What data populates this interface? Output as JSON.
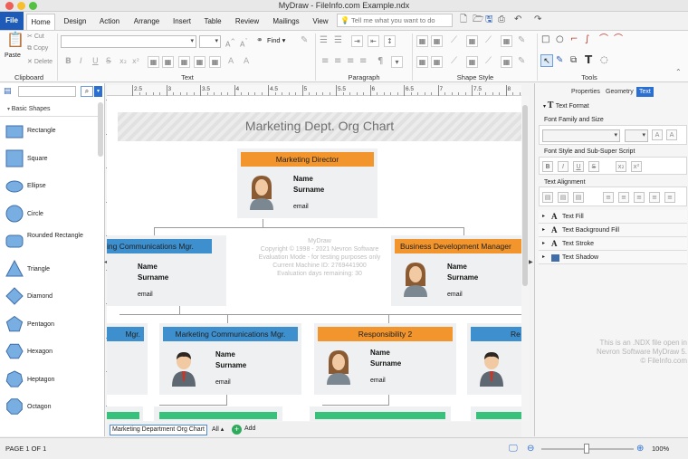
{
  "window": {
    "title": "MyDraw - FileInfo.com Example.ndx"
  },
  "ribbon": {
    "file_tab": "File",
    "tabs": [
      "Home",
      "Design",
      "Action",
      "Arrange",
      "Insert",
      "Table",
      "Review",
      "Mailings",
      "View"
    ],
    "search_placeholder": "Tell me what you want to do",
    "clipboard": {
      "paste": "Paste",
      "cut": "Cut",
      "copy": "Copy",
      "delete": "Delete"
    },
    "find_label": "Find",
    "groups": [
      "Clipboard",
      "Text",
      "Paragraph",
      "Shape Style",
      "Tools"
    ]
  },
  "left_panel": {
    "category": "Basic Shapes",
    "shapes": [
      "Rectangle",
      "Square",
      "Ellipse",
      "Circle",
      "Rounded Rectangle",
      "Triangle",
      "Diamond",
      "Pentagon",
      "Hexagon",
      "Heptagon",
      "Octagon"
    ]
  },
  "rulers": {
    "top_ticks": [
      "2.5",
      "3",
      "3.5",
      "4",
      "4.5",
      "5",
      "5.5",
      "6",
      "6.5",
      "7",
      "7.5",
      "8"
    ]
  },
  "diagram": {
    "title": "Marketing Dept. Org Chart",
    "cards": [
      {
        "title": "Marketing Director",
        "name": "Name",
        "surname": "Surname",
        "email": "email"
      },
      {
        "title": "ing Communications Mgr.",
        "name": "Name",
        "surname": "Surname",
        "email": "email"
      },
      {
        "title": "Business Development Manager",
        "name": "Name",
        "surname": "Surname",
        "email": "email"
      },
      {
        "title": "Mgr."
      },
      {
        "title": "Marketing Communications Mgr.",
        "name": "Name",
        "surname": "Surname",
        "email": "email"
      },
      {
        "title": "Responsibility 2",
        "name": "Name",
        "surname": "Surname",
        "email": "email"
      },
      {
        "title": "Re"
      }
    ],
    "watermark": [
      "MyDraw",
      "Copyright © 1998 - 2021 Nevron Software",
      "Evaluation Mode - for testing purposes only",
      "Current Machine ID: 2769441900",
      "Evaluation days remaining: 30"
    ]
  },
  "page_tabs": {
    "current": "Marketing Department Org Chart",
    "all": "All",
    "add": "Add"
  },
  "right_panel": {
    "tabs": [
      "Properties",
      "Geometry",
      "Text"
    ],
    "title": "Text Format",
    "font_section": "Font Family and Size",
    "style_section": "Font Style and Sub-Super Script",
    "align_section": "Text Alignment",
    "expanders": [
      "Text Fill",
      "Text Background Fill",
      "Text Stroke",
      "Text Shadow"
    ],
    "info": [
      "This is an .NDX file open in",
      "Nevron Software MyDraw 5.",
      "© FileInfo.com"
    ]
  },
  "status": {
    "page": "PAGE 1 OF 1",
    "zoom": "100%"
  },
  "colors": {
    "accent": "#1e5bb8",
    "orange": "#f2952c",
    "blue": "#3d8fce",
    "green": "#36c27a"
  }
}
